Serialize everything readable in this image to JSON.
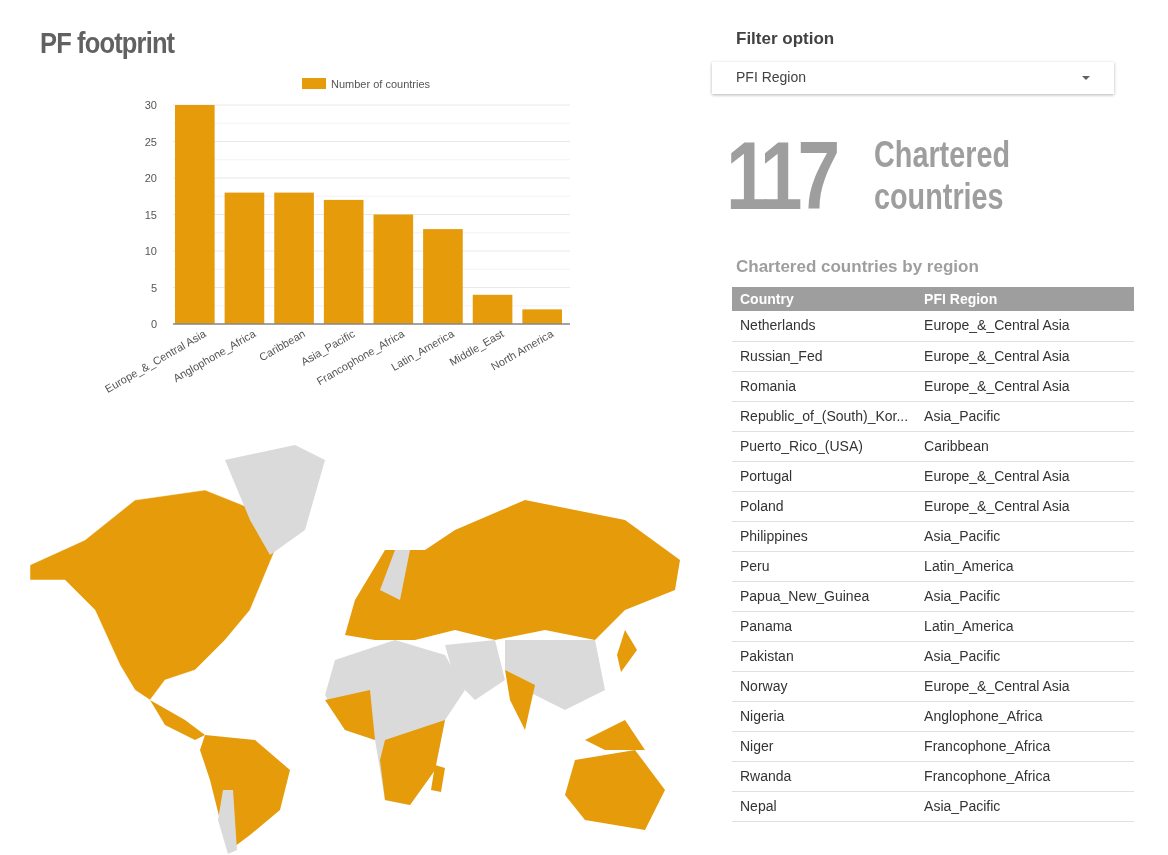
{
  "title": "PF footprint",
  "chart": {
    "chart_data": {
      "type": "bar",
      "series": [
        {
          "name": "Number of countries",
          "color": "#e69b0a",
          "values": [
            30,
            18,
            18,
            17,
            15,
            13,
            4,
            2
          ]
        }
      ],
      "categories": [
        "Europe_&_Central Asia",
        "Anglophone_Africa",
        "Caribbean",
        "Asia_Pacific",
        "Francophone_Africa",
        "Latin_America",
        "Middle_East",
        "North America"
      ],
      "ylim": [
        0,
        30
      ],
      "grid": true,
      "yticks": [
        0,
        5,
        10,
        15,
        20,
        25,
        30
      ]
    }
  },
  "filter": {
    "label": "Filter option",
    "placeholder": "PFI Region"
  },
  "scorecard": {
    "value": "117",
    "label": "Chartered countries"
  },
  "table": {
    "title": "Chartered countries by region",
    "columns": [
      "Country",
      "PFI Region"
    ],
    "rows": [
      [
        "Netherlands",
        "Europe_&_Central Asia"
      ],
      [
        "Russian_Fed",
        "Europe_&_Central Asia"
      ],
      [
        "Romania",
        "Europe_&_Central Asia"
      ],
      [
        "Republic_of_(South)_Kor...",
        "Asia_Pacific"
      ],
      [
        "Puerto_Rico_(USA)",
        "Caribbean"
      ],
      [
        "Portugal",
        "Europe_&_Central Asia"
      ],
      [
        "Poland",
        "Europe_&_Central Asia"
      ],
      [
        "Philippines",
        "Asia_Pacific"
      ],
      [
        "Peru",
        "Latin_America"
      ],
      [
        "Papua_New_Guinea",
        "Asia_Pacific"
      ],
      [
        "Panama",
        "Latin_America"
      ],
      [
        "Pakistan",
        "Asia_Pacific"
      ],
      [
        "Norway",
        "Europe_&_Central Asia"
      ],
      [
        "Nigeria",
        "Anglophone_Africa"
      ],
      [
        "Niger",
        "Francophone_Africa"
      ],
      [
        "Rwanda",
        "Francophone_Africa"
      ],
      [
        "Nepal",
        "Asia_Pacific"
      ]
    ]
  }
}
